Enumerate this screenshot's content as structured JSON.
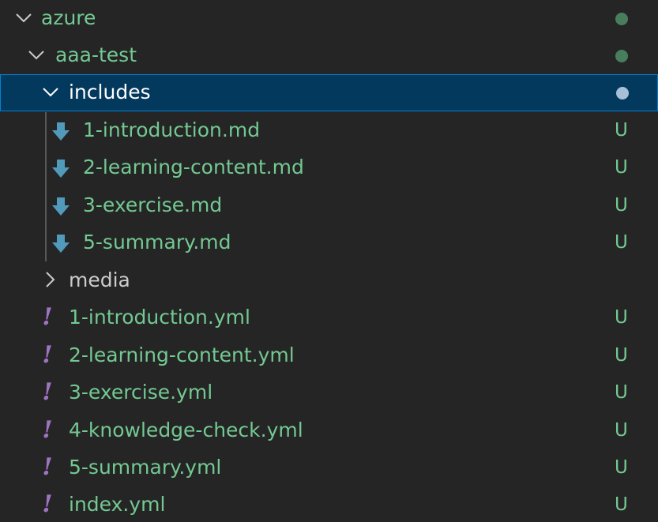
{
  "explorer": {
    "root": {
      "label": "azure"
    },
    "project": {
      "label": "aaa-test"
    },
    "includes_folder": {
      "label": "includes"
    },
    "includes_files": [
      {
        "label": "1-introduction.md",
        "status": "U",
        "icon": "markdown-download-icon"
      },
      {
        "label": "2-learning-content.md",
        "status": "U",
        "icon": "markdown-download-icon"
      },
      {
        "label": "3-exercise.md",
        "status": "U",
        "icon": "markdown-download-icon"
      },
      {
        "label": "5-summary.md",
        "status": "U",
        "icon": "markdown-download-icon"
      }
    ],
    "media_folder": {
      "label": "media"
    },
    "yml_files": [
      {
        "label": "1-introduction.yml",
        "status": "U",
        "icon": "yaml-exclamation-icon"
      },
      {
        "label": "2-learning-content.yml",
        "status": "U",
        "icon": "yaml-exclamation-icon"
      },
      {
        "label": "3-exercise.yml",
        "status": "U",
        "icon": "yaml-exclamation-icon"
      },
      {
        "label": "4-knowledge-check.yml",
        "status": "U",
        "icon": "yaml-exclamation-icon"
      },
      {
        "label": "5-summary.yml",
        "status": "U",
        "icon": "yaml-exclamation-icon"
      },
      {
        "label": "index.yml",
        "status": "U",
        "icon": "yaml-exclamation-icon"
      }
    ],
    "yaml_icon_glyph": "!",
    "colors": {
      "background": "#252526",
      "untracked_text": "#73c991",
      "selection_background": "#04395e",
      "selection_border": "#007fd4",
      "markdown_icon": "#519aba",
      "yaml_icon": "#a074c4",
      "folder_status_dot": "#487e5b"
    }
  }
}
